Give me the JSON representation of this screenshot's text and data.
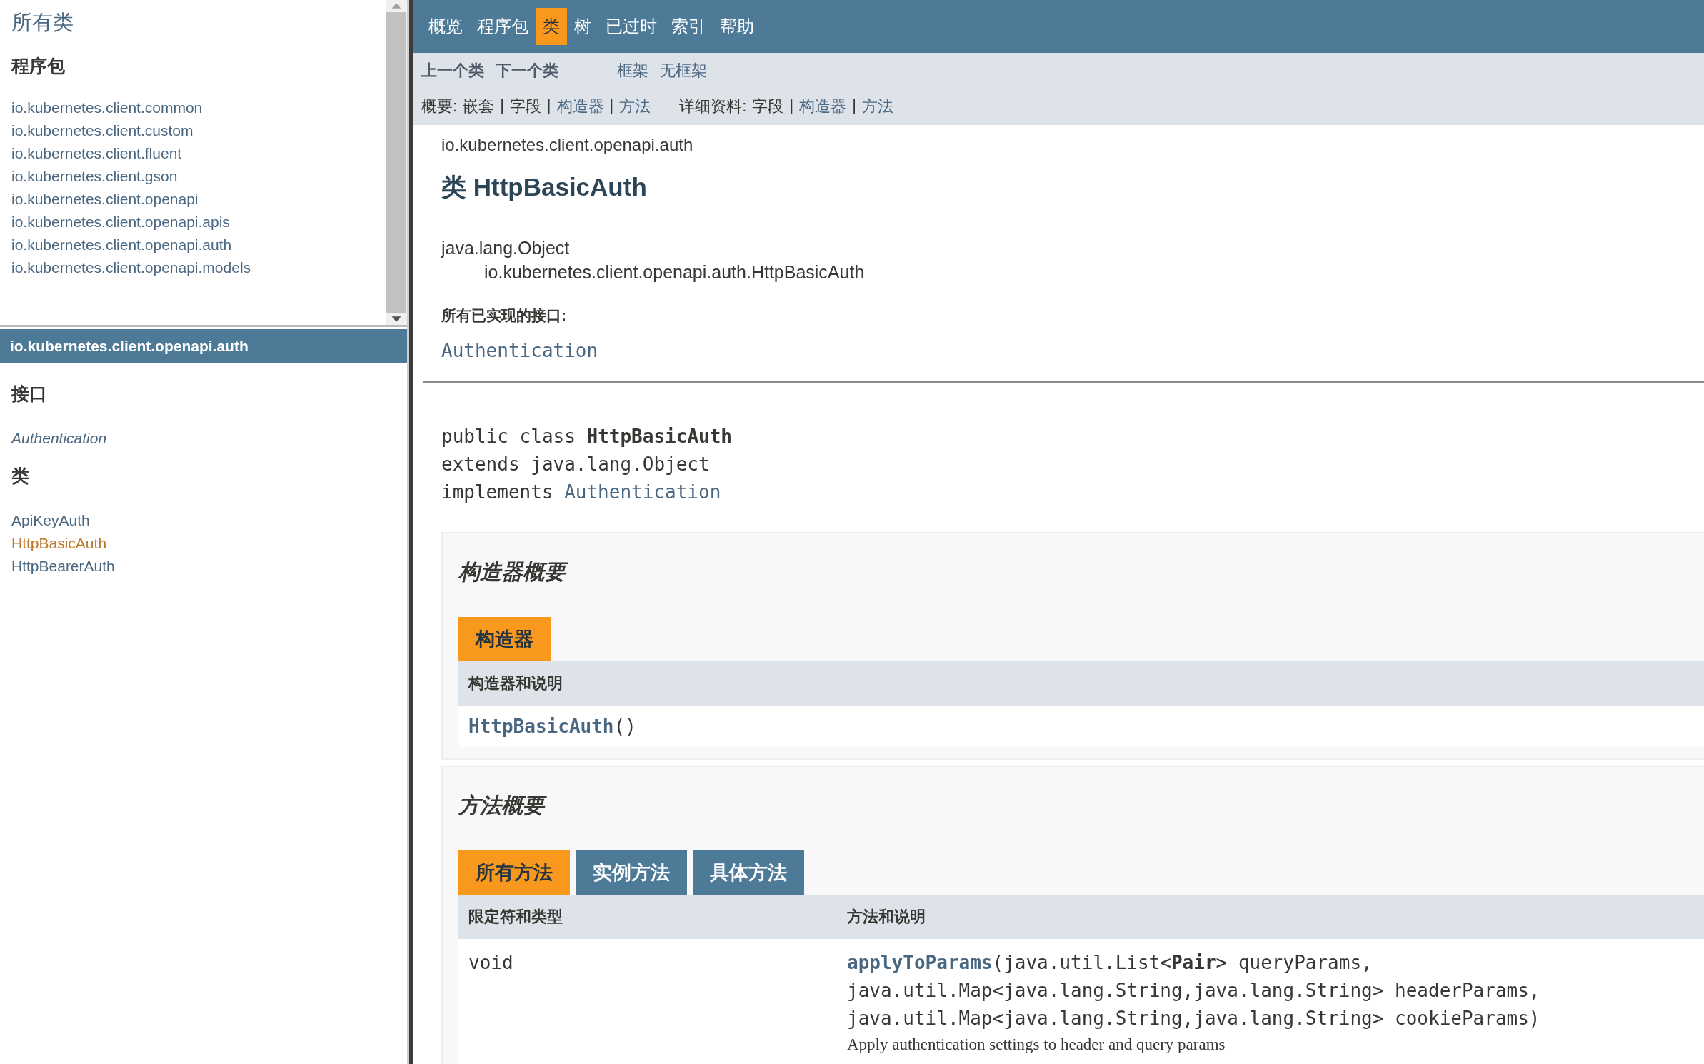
{
  "all_classes_frame": {
    "title": "所有类",
    "packages_heading": "程序包",
    "packages": [
      {
        "label": "io.kubernetes.client.common"
      },
      {
        "label": "io.kubernetes.client.custom"
      },
      {
        "label": "io.kubernetes.client.fluent"
      },
      {
        "label": "io.kubernetes.client.gson"
      },
      {
        "label": "io.kubernetes.client.openapi"
      },
      {
        "label": "io.kubernetes.client.openapi.apis"
      },
      {
        "label": "io.kubernetes.client.openapi.auth"
      },
      {
        "label": "io.kubernetes.client.openapi.models"
      }
    ]
  },
  "package_frame": {
    "title": "io.kubernetes.client.openapi.auth",
    "sections": [
      {
        "heading": "接口",
        "kind": "interface",
        "items": [
          {
            "label": "Authentication",
            "selected": false
          }
        ]
      },
      {
        "heading": "类",
        "kind": "class",
        "items": [
          {
            "label": "ApiKeyAuth",
            "selected": false
          },
          {
            "label": "HttpBasicAuth",
            "selected": true
          },
          {
            "label": "HttpBearerAuth",
            "selected": false
          }
        ]
      }
    ]
  },
  "nav": {
    "tabs": [
      {
        "label": "概览",
        "selected": false
      },
      {
        "label": "程序包",
        "selected": false
      },
      {
        "label": "类",
        "selected": true
      },
      {
        "label": "树",
        "selected": false
      },
      {
        "label": "已过时",
        "selected": false
      },
      {
        "label": "索引",
        "selected": false
      },
      {
        "label": "帮助",
        "selected": false
      }
    ]
  },
  "subnav": {
    "class_links": [
      {
        "label": "上一个类",
        "link": false
      },
      {
        "label": "下一个类",
        "link": false
      }
    ],
    "frame_links": [
      {
        "label": "框架",
        "link": true
      },
      {
        "label": "无框架",
        "link": true
      }
    ],
    "summary": {
      "label": "概要:",
      "items": [
        {
          "label": "嵌套",
          "link": false
        },
        {
          "label": "字段",
          "link": false,
          "sep": "|"
        },
        {
          "label": "构造器",
          "link": true,
          "sep": "|"
        },
        {
          "label": "方法",
          "link": true,
          "sep": "|"
        }
      ]
    },
    "detail": {
      "label": "详细资料:",
      "items": [
        {
          "label": "字段",
          "link": false
        },
        {
          "label": "构造器",
          "link": true,
          "sep": "|"
        },
        {
          "label": "方法",
          "link": true,
          "sep": "|"
        }
      ]
    }
  },
  "header": {
    "package": "io.kubernetes.client.openapi.auth",
    "title": "类 HttpBasicAuth"
  },
  "inheritance": [
    "java.lang.Object",
    "io.kubernetes.client.openapi.auth.HttpBasicAuth"
  ],
  "implemented": {
    "label": "所有已实现的接口:",
    "links": [
      "Authentication"
    ]
  },
  "signature": [
    {
      "text": "public class **HttpBasicAuth**"
    },
    {
      "text": "extends java.lang.Object"
    },
    {
      "text": "implements",
      "link": "Authentication"
    }
  ],
  "constructor_summary": {
    "title": "构造器概要",
    "tabs": [
      {
        "label": "构造器",
        "selected": true
      }
    ],
    "columns": [
      "构造器和说明"
    ],
    "rows": [
      {
        "name": "HttpBasicAuth",
        "params": "()"
      }
    ]
  },
  "method_summary": {
    "title": "方法概要",
    "tabs": [
      {
        "label": "所有方法",
        "selected": true
      },
      {
        "label": "实例方法",
        "selected": false
      },
      {
        "label": "具体方法",
        "selected": false
      }
    ],
    "columns": [
      "限定符和类型",
      "方法和说明"
    ],
    "rows": [
      {
        "type": "void",
        "name": "applyToParams",
        "lines": [
          "(java.util.List<**Pair**> queryParams,",
          "java.util.Map<java.lang.String,java.lang.String> headerParams,",
          "java.util.Map<java.lang.String,java.lang.String> cookieParams)"
        ],
        "description": "Apply authentication settings to header and query params"
      }
    ]
  }
}
